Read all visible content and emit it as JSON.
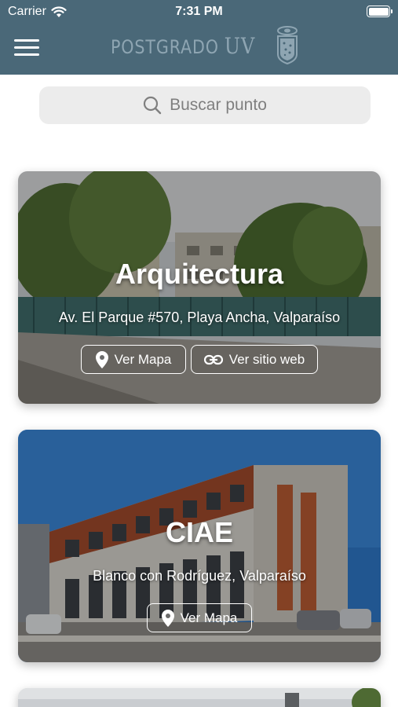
{
  "status_bar": {
    "carrier": "Carrier",
    "time": "7:31 PM"
  },
  "header": {
    "logo_text": "POSTGRADO",
    "logo_uv": "UV"
  },
  "search": {
    "placeholder": "Buscar punto"
  },
  "cards": [
    {
      "title": "Arquitectura",
      "address": "Av. El Parque #570, Playa Ancha, Valparaíso",
      "map_button": "Ver Mapa",
      "web_button": "Ver sitio web"
    },
    {
      "title": "CIAE",
      "address": "Blanco con Rodríguez, Valparaíso",
      "map_button": "Ver Mapa"
    }
  ],
  "colors": {
    "header_bg": "#4a6878",
    "logo_color": "#8ea5b2",
    "search_bg": "#ececec"
  }
}
